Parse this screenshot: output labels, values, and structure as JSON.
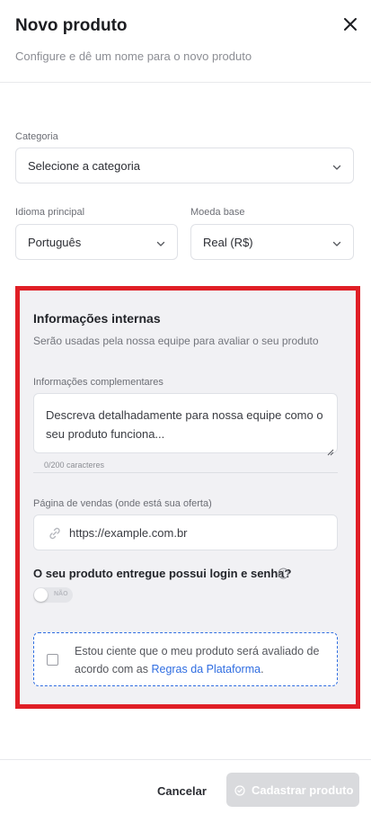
{
  "header": {
    "title": "Novo produto",
    "subtitle": "Configure e dê um nome para o novo produto"
  },
  "form": {
    "category": {
      "label": "Categoria",
      "value": "Selecione a categoria"
    },
    "language": {
      "label": "Idioma principal",
      "value": "Português"
    },
    "currency": {
      "label": "Moeda base",
      "value": "Real (R$)"
    }
  },
  "internal": {
    "title": "Informações internas",
    "subtitle": "Serão usadas pela nossa equipe para avaliar o seu produto",
    "complementary": {
      "label": "Informações complementares",
      "placeholder": "Descreva detalhadamente para nossa equipe como o seu produto funciona...",
      "counter": "0/200 caracteres"
    },
    "sales_page": {
      "label": "Página de vendas (onde está sua oferta)",
      "placeholder": "https://example.com.br"
    },
    "login_question": "O seu produto entregue possui login e senha?",
    "login_toggle": {
      "label": "NÃO",
      "value": false
    },
    "agreement": {
      "text": "Estou ciente que o meu produto será avaliado de acordo com as ",
      "link": "Regras da Plataforma",
      "suffix": "."
    }
  },
  "footer": {
    "cancel": "Cancelar",
    "submit": "Cadastrar produto"
  },
  "colors": {
    "highlight_border": "#e01f26",
    "link": "#2f6de1",
    "disabled_button": "#d9dadd"
  }
}
